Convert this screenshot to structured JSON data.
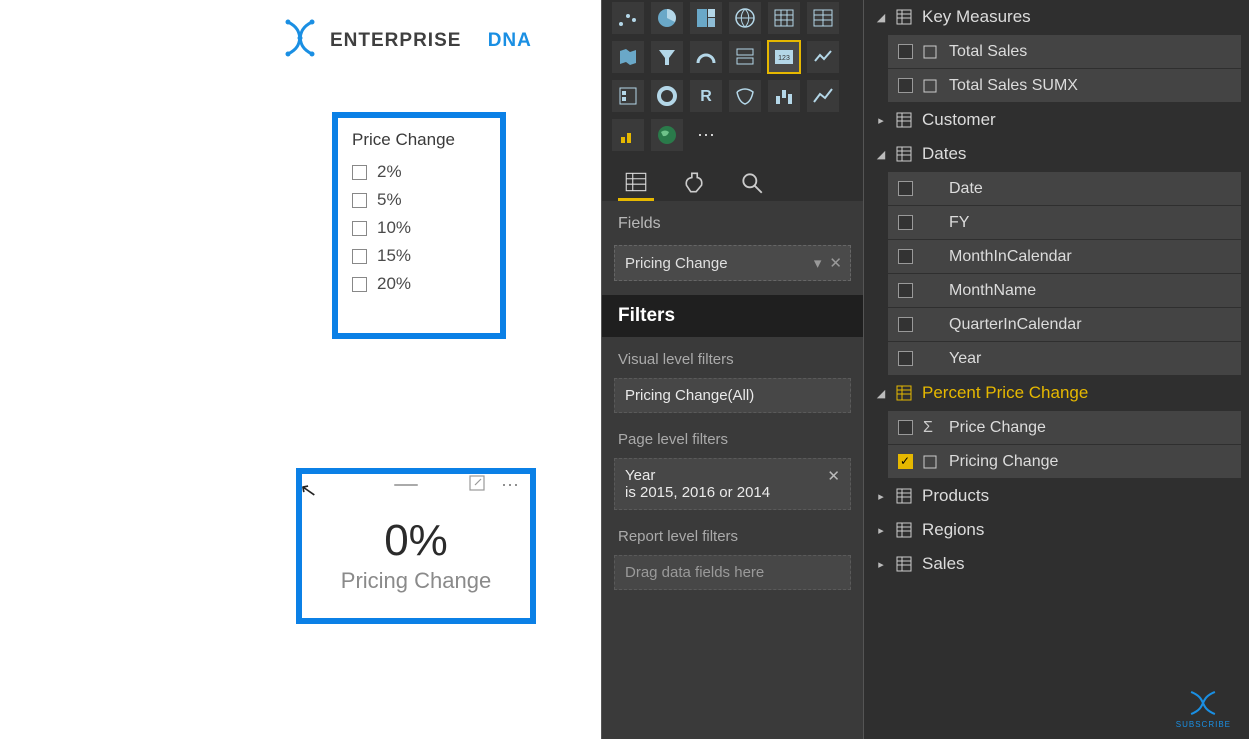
{
  "logo": {
    "text1": "ENTERPRISE",
    "text2": "DNA"
  },
  "slicer": {
    "title": "Price Change",
    "items": [
      "2%",
      "5%",
      "10%",
      "15%",
      "20%"
    ]
  },
  "card": {
    "value": "0%",
    "label": "Pricing Change"
  },
  "viz": {
    "fields_tab_label": "Fields",
    "field_well_value": "Pricing Change",
    "filters_header": "Filters",
    "visual_filters_label": "Visual level filters",
    "visual_filter_box": "Pricing Change(All)",
    "page_filters_label": "Page level filters",
    "page_filter_line1": "Year",
    "page_filter_line2": "is 2015, 2016 or 2014",
    "report_filters_label": "Report level filters",
    "report_filter_placeholder": "Drag data fields here"
  },
  "fields": {
    "key_measures": {
      "label": "Key Measures",
      "items": [
        "Total Sales",
        "Total Sales SUMX"
      ]
    },
    "customer": {
      "label": "Customer"
    },
    "dates": {
      "label": "Dates",
      "items": [
        "Date",
        "FY",
        "MonthInCalendar",
        "MonthName",
        "QuarterInCalendar",
        "Year"
      ]
    },
    "ppc": {
      "label": "Percent Price Change",
      "items": [
        {
          "label": "Price Change",
          "icon": "sigma",
          "checked": false
        },
        {
          "label": "Pricing Change",
          "icon": "measure",
          "checked": true
        }
      ]
    },
    "products": {
      "label": "Products"
    },
    "regions": {
      "label": "Regions"
    },
    "sales": {
      "label": "Sales"
    }
  },
  "subscribe": "SUBSCRIBE"
}
